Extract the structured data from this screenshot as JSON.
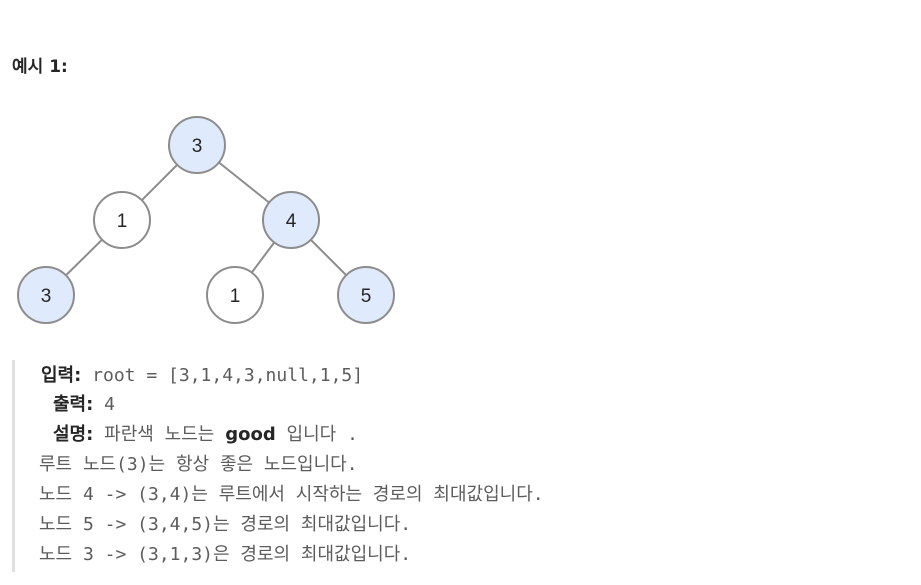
{
  "example": {
    "title": "예시 1:"
  },
  "tree": {
    "nodes": [
      {
        "id": "n1",
        "value": "3",
        "good": true
      },
      {
        "id": "n2",
        "value": "1",
        "good": false
      },
      {
        "id": "n3",
        "value": "4",
        "good": true
      },
      {
        "id": "n4",
        "value": "3",
        "good": true
      },
      {
        "id": "n5",
        "value": "1",
        "good": false
      },
      {
        "id": "n6",
        "value": "5",
        "good": true
      }
    ],
    "colors": {
      "good_fill": "#dfeafd",
      "normal_fill": "#ffffff",
      "stroke": "#8c8c8c"
    }
  },
  "io": {
    "input_label": "입력:",
    "input_value": " root = [3,1,4,3,null,1,5]",
    "output_label": "출력:",
    "output_value": " 4",
    "explain_label": "설명:",
    "explain_pre": " 파란색 노드는 ",
    "explain_keyword": "good",
    "explain_post": " 입니다 .",
    "lines": [
      "루트 노드(3)는 항상 좋은 노드입니다.",
      "노드 4 -> (3,4)는 루트에서 시작하는 경로의 최대값입니다.",
      "노드 5 -> (3,4,5)는 경로의 최대값입니다.",
      "노드 3 -> (3,1,3)은 경로의 최대값입니다."
    ]
  }
}
